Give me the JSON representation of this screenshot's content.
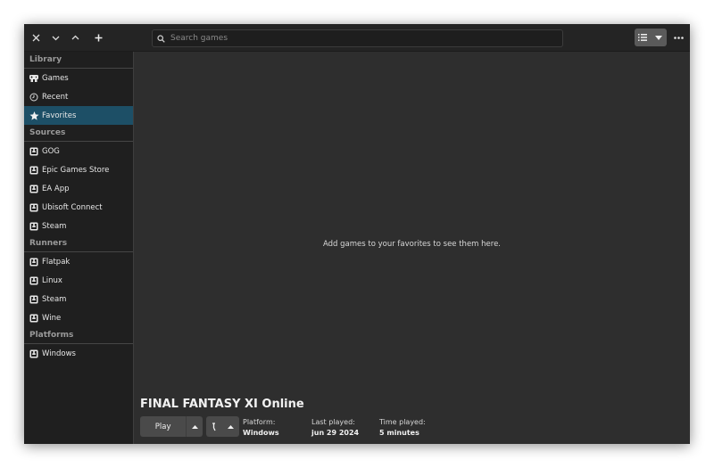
{
  "header": {
    "search_placeholder": "Search games"
  },
  "sidebar": {
    "sections": [
      {
        "title": "Library",
        "items": [
          {
            "label": "Games",
            "icon": "gamepad-icon"
          },
          {
            "label": "Recent",
            "icon": "clock-icon"
          },
          {
            "label": "Favorites",
            "icon": "star-icon",
            "active": true
          }
        ]
      },
      {
        "title": "Sources",
        "items": [
          {
            "label": "GOG",
            "icon": "source-icon"
          },
          {
            "label": "Epic Games Store",
            "icon": "source-icon"
          },
          {
            "label": "EA App",
            "icon": "source-icon"
          },
          {
            "label": "Ubisoft Connect",
            "icon": "source-icon"
          },
          {
            "label": "Steam",
            "icon": "source-icon"
          }
        ]
      },
      {
        "title": "Runners",
        "items": [
          {
            "label": "Flatpak",
            "icon": "runner-icon"
          },
          {
            "label": "Linux",
            "icon": "runner-icon"
          },
          {
            "label": "Steam",
            "icon": "runner-icon"
          },
          {
            "label": "Wine",
            "icon": "runner-icon"
          }
        ]
      },
      {
        "title": "Platforms",
        "items": [
          {
            "label": "Windows",
            "icon": "platform-icon"
          }
        ]
      }
    ]
  },
  "main": {
    "empty_message": "Add games to your favorites to see them here.",
    "game_title": "FINAL FANTASY XI Online",
    "play_label": "Play",
    "platform_label": "Platform:",
    "platform_value": "Windows",
    "last_played_label": "Last played:",
    "last_played_value": "jun 29 2024",
    "time_played_label": "Time played:",
    "time_played_value": "5 minutes"
  },
  "colors": {
    "active_item": "#1d4f66",
    "sidebar_bg": "#1f1f1f",
    "main_bg": "#2e2e2e"
  }
}
